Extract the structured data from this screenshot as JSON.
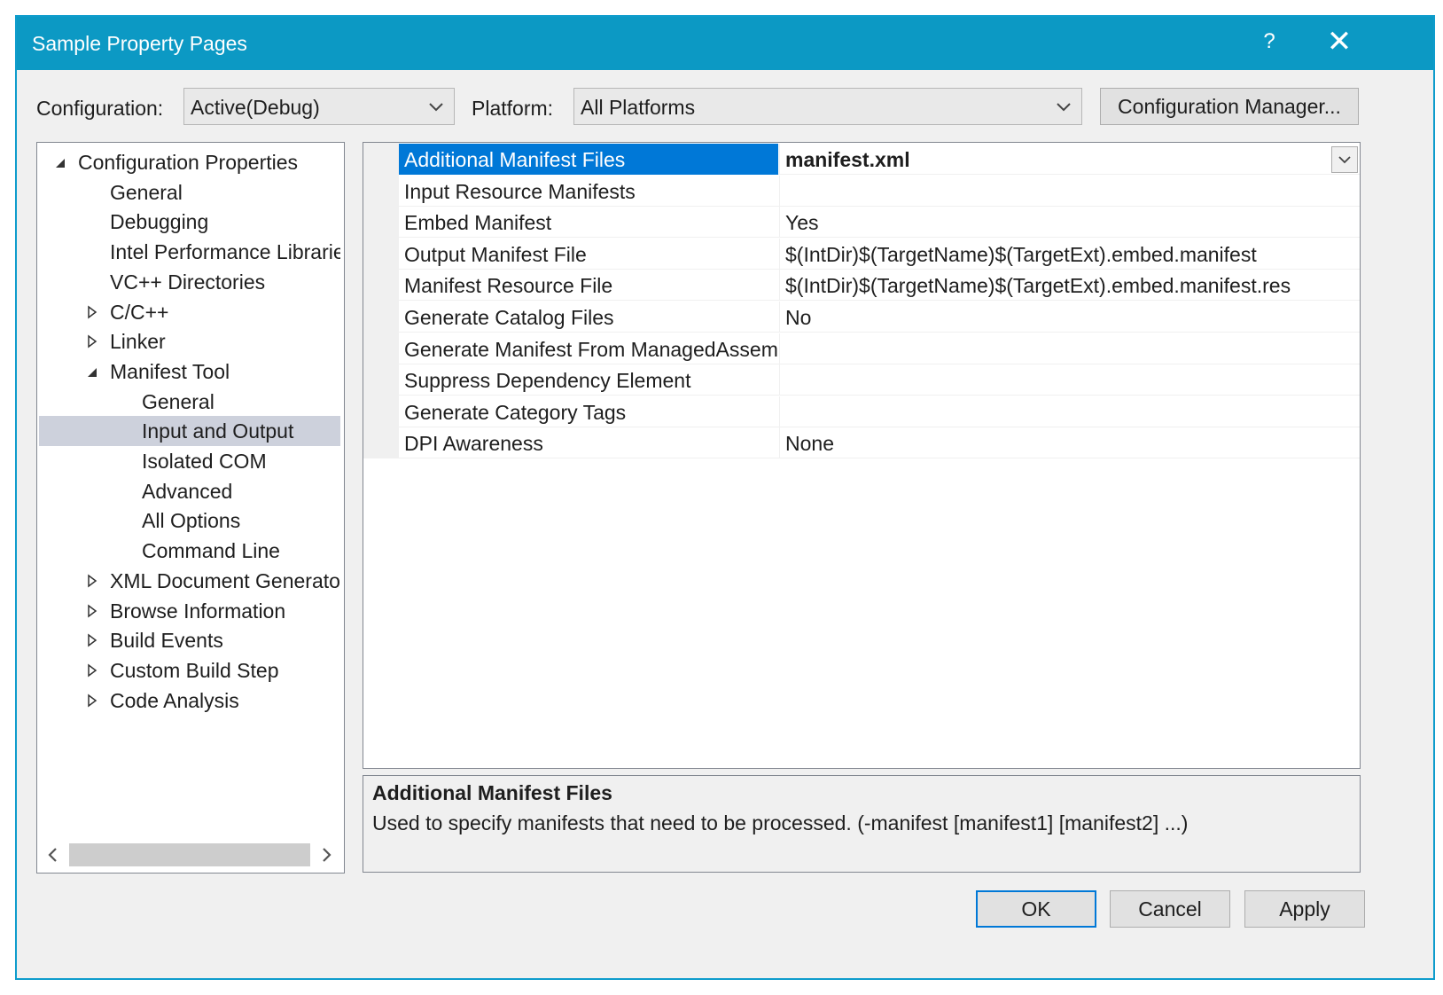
{
  "window": {
    "title": "Sample Property Pages",
    "help_label": "?",
    "close_label": "✕"
  },
  "toolbar": {
    "configuration_label": "Configuration:",
    "configuration_value": "Active(Debug)",
    "platform_label": "Platform:",
    "platform_value": "All Platforms",
    "config_manager_label": "Configuration Manager..."
  },
  "tree": {
    "items": [
      {
        "label": "Configuration Properties",
        "level": 0,
        "state": "expanded"
      },
      {
        "label": "General",
        "level": 1,
        "state": "leaf"
      },
      {
        "label": "Debugging",
        "level": 1,
        "state": "leaf"
      },
      {
        "label": "Intel Performance Libraries",
        "level": 1,
        "state": "leaf"
      },
      {
        "label": "VC++ Directories",
        "level": 1,
        "state": "leaf"
      },
      {
        "label": "C/C++",
        "level": 1,
        "state": "collapsed"
      },
      {
        "label": "Linker",
        "level": 1,
        "state": "collapsed"
      },
      {
        "label": "Manifest Tool",
        "level": 1,
        "state": "expanded"
      },
      {
        "label": "General",
        "level": 2,
        "state": "leaf"
      },
      {
        "label": "Input and Output",
        "level": 2,
        "state": "leaf",
        "selected": true
      },
      {
        "label": "Isolated COM",
        "level": 2,
        "state": "leaf"
      },
      {
        "label": "Advanced",
        "level": 2,
        "state": "leaf"
      },
      {
        "label": "All Options",
        "level": 2,
        "state": "leaf"
      },
      {
        "label": "Command Line",
        "level": 2,
        "state": "leaf"
      },
      {
        "label": "XML Document Generator",
        "level": 1,
        "state": "collapsed"
      },
      {
        "label": "Browse Information",
        "level": 1,
        "state": "collapsed"
      },
      {
        "label": "Build Events",
        "level": 1,
        "state": "collapsed"
      },
      {
        "label": "Custom Build Step",
        "level": 1,
        "state": "collapsed"
      },
      {
        "label": "Code Analysis",
        "level": 1,
        "state": "collapsed"
      }
    ]
  },
  "properties": {
    "rows": [
      {
        "name": "Additional Manifest Files",
        "value": "manifest.xml",
        "selected": true
      },
      {
        "name": "Input Resource Manifests",
        "value": ""
      },
      {
        "name": "Embed Manifest",
        "value": "Yes"
      },
      {
        "name": "Output Manifest File",
        "value": "$(IntDir)$(TargetName)$(TargetExt).embed.manifest"
      },
      {
        "name": "Manifest Resource File",
        "value": "$(IntDir)$(TargetName)$(TargetExt).embed.manifest.res"
      },
      {
        "name": "Generate Catalog Files",
        "value": "No"
      },
      {
        "name": "Generate Manifest From ManagedAssembl",
        "value": ""
      },
      {
        "name": "Suppress Dependency Element",
        "value": ""
      },
      {
        "name": "Generate Category Tags",
        "value": ""
      },
      {
        "name": "DPI Awareness",
        "value": "None"
      }
    ]
  },
  "description": {
    "title": "Additional Manifest Files",
    "text": "Used to specify manifests that need to be processed. (-manifest [manifest1] [manifest2] ...)"
  },
  "buttons": {
    "ok": "OK",
    "cancel": "Cancel",
    "apply": "Apply"
  },
  "colors": {
    "titlebar": "#0c99c4",
    "selection": "#0078d7",
    "tree_selection": "#cdd1dc"
  }
}
